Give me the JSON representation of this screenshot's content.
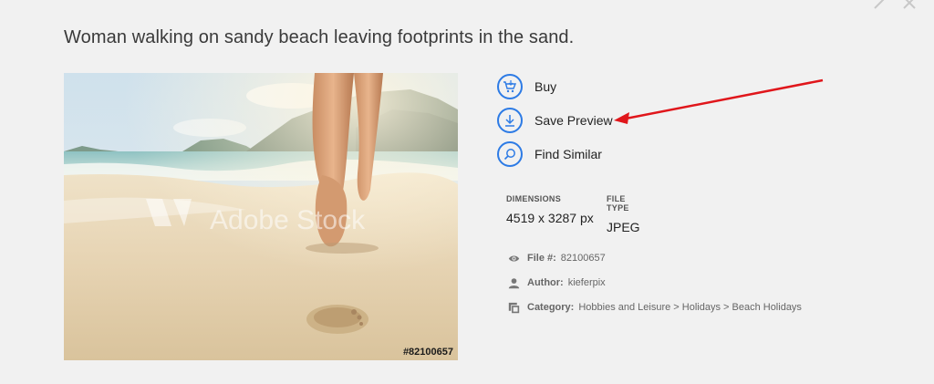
{
  "page": {
    "title": "Woman walking on sandy beach leaving footprints in the sand."
  },
  "image": {
    "watermark": "Adobe Stock",
    "id_label": "#82100657"
  },
  "actions": [
    {
      "label": "Buy",
      "icon": "cart-icon"
    },
    {
      "label": "Save Preview",
      "icon": "download-icon"
    },
    {
      "label": "Find Similar",
      "icon": "search-icon"
    }
  ],
  "metadata": {
    "dimensions_label": "DIMENSIONS",
    "dimensions_value": "4519 x 3287 px",
    "filetype_label": "FILE TYPE",
    "filetype_value": "JPEG"
  },
  "info": {
    "file_label": "File #:",
    "file_value": "82100657",
    "author_label": "Author:",
    "author_value": "kieferpix",
    "category_label": "Category:",
    "category_value": "Hobbies and Leisure > Holidays > Beach Holidays"
  },
  "colors": {
    "accent": "#2d7be5",
    "annotation_arrow": "#e0161b",
    "background": "#f1f1f1"
  }
}
